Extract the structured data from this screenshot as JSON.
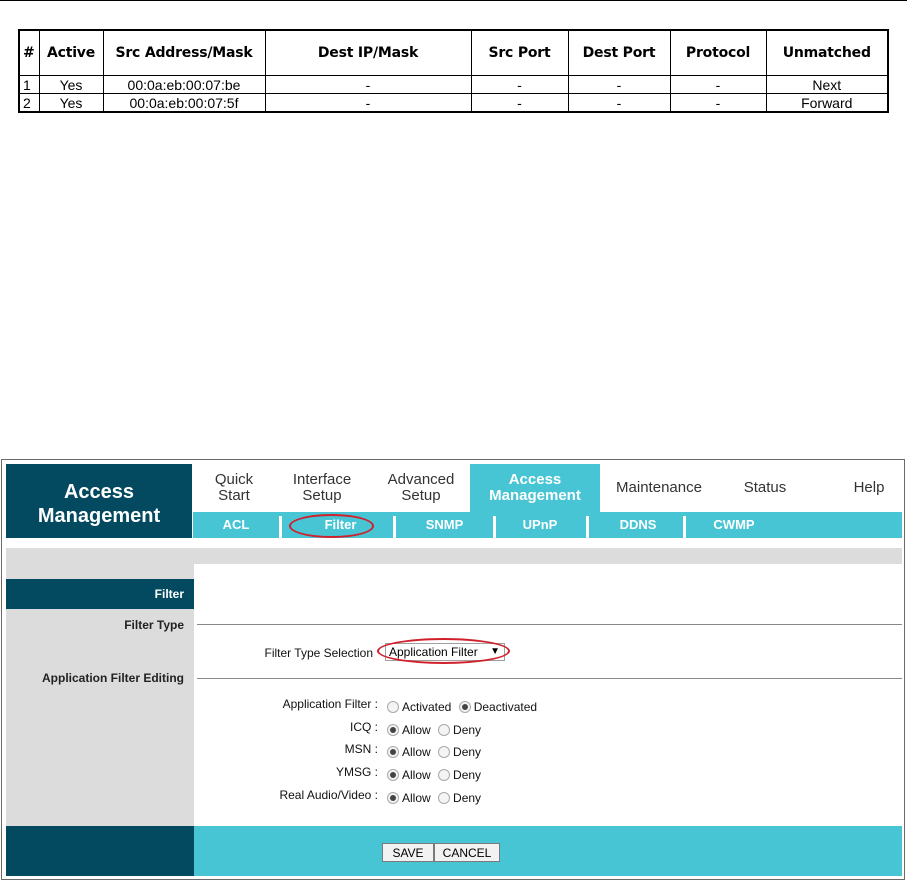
{
  "rule_table": {
    "headers": {
      "num": "#",
      "active": "Active",
      "src": "Src Address/Mask",
      "dest_ip": "Dest IP/Mask",
      "src_port": "Src Port",
      "dest_port": "Dest Port",
      "protocol": "Protocol",
      "unmatched": "Unmatched"
    },
    "rows": [
      {
        "num": "1",
        "active": "Yes",
        "src": "00:0a:eb:00:07:be",
        "dest_ip": "-",
        "src_port": "-",
        "dest_port": "-",
        "protocol": "-",
        "unmatched": "Next"
      },
      {
        "num": "2",
        "active": "Yes",
        "src": "00:0a:eb:00:07:5f",
        "dest_ip": "-",
        "src_port": "-",
        "dest_port": "-",
        "protocol": "-",
        "unmatched": "Forward"
      }
    ]
  },
  "router": {
    "brand_line1": "Access",
    "brand_line2": "Management",
    "menu": [
      {
        "l1": "Quick",
        "l2": "Start"
      },
      {
        "l1": "Interface",
        "l2": "Setup"
      },
      {
        "l1": "Advanced",
        "l2": "Setup"
      },
      {
        "l1": "Access",
        "l2": "Management"
      },
      {
        "l1": "Maintenance",
        "l2": ""
      },
      {
        "l1": "Status",
        "l2": ""
      },
      {
        "l1": "Help",
        "l2": ""
      }
    ],
    "submenu": [
      "ACL",
      "Filter",
      "SNMP",
      "UPnP",
      "DDNS",
      "CWMP"
    ],
    "sidebar": {
      "header": "Filter",
      "filter_type": "Filter Type",
      "app_filter_editing": "Application Filter Editing"
    },
    "filter_type_selection_label": "Filter Type Selection",
    "filter_type_value": "Application Filter",
    "app_filter": {
      "label": "Application Filter :",
      "opt1": "Activated",
      "opt2": "Deactivated"
    },
    "rows": [
      {
        "label": "ICQ :",
        "opt1": "Allow",
        "opt2": "Deny"
      },
      {
        "label": "MSN :",
        "opt1": "Allow",
        "opt2": "Deny"
      },
      {
        "label": "YMSG :",
        "opt1": "Allow",
        "opt2": "Deny"
      },
      {
        "label": "Real Audio/Video :",
        "opt1": "Allow",
        "opt2": "Deny"
      }
    ],
    "save_label": "SAVE",
    "cancel_label": "CANCEL",
    "colors": {
      "dark_teal": "#034a61",
      "cyan": "#48c5d4",
      "highlight": "#d0202c"
    }
  }
}
